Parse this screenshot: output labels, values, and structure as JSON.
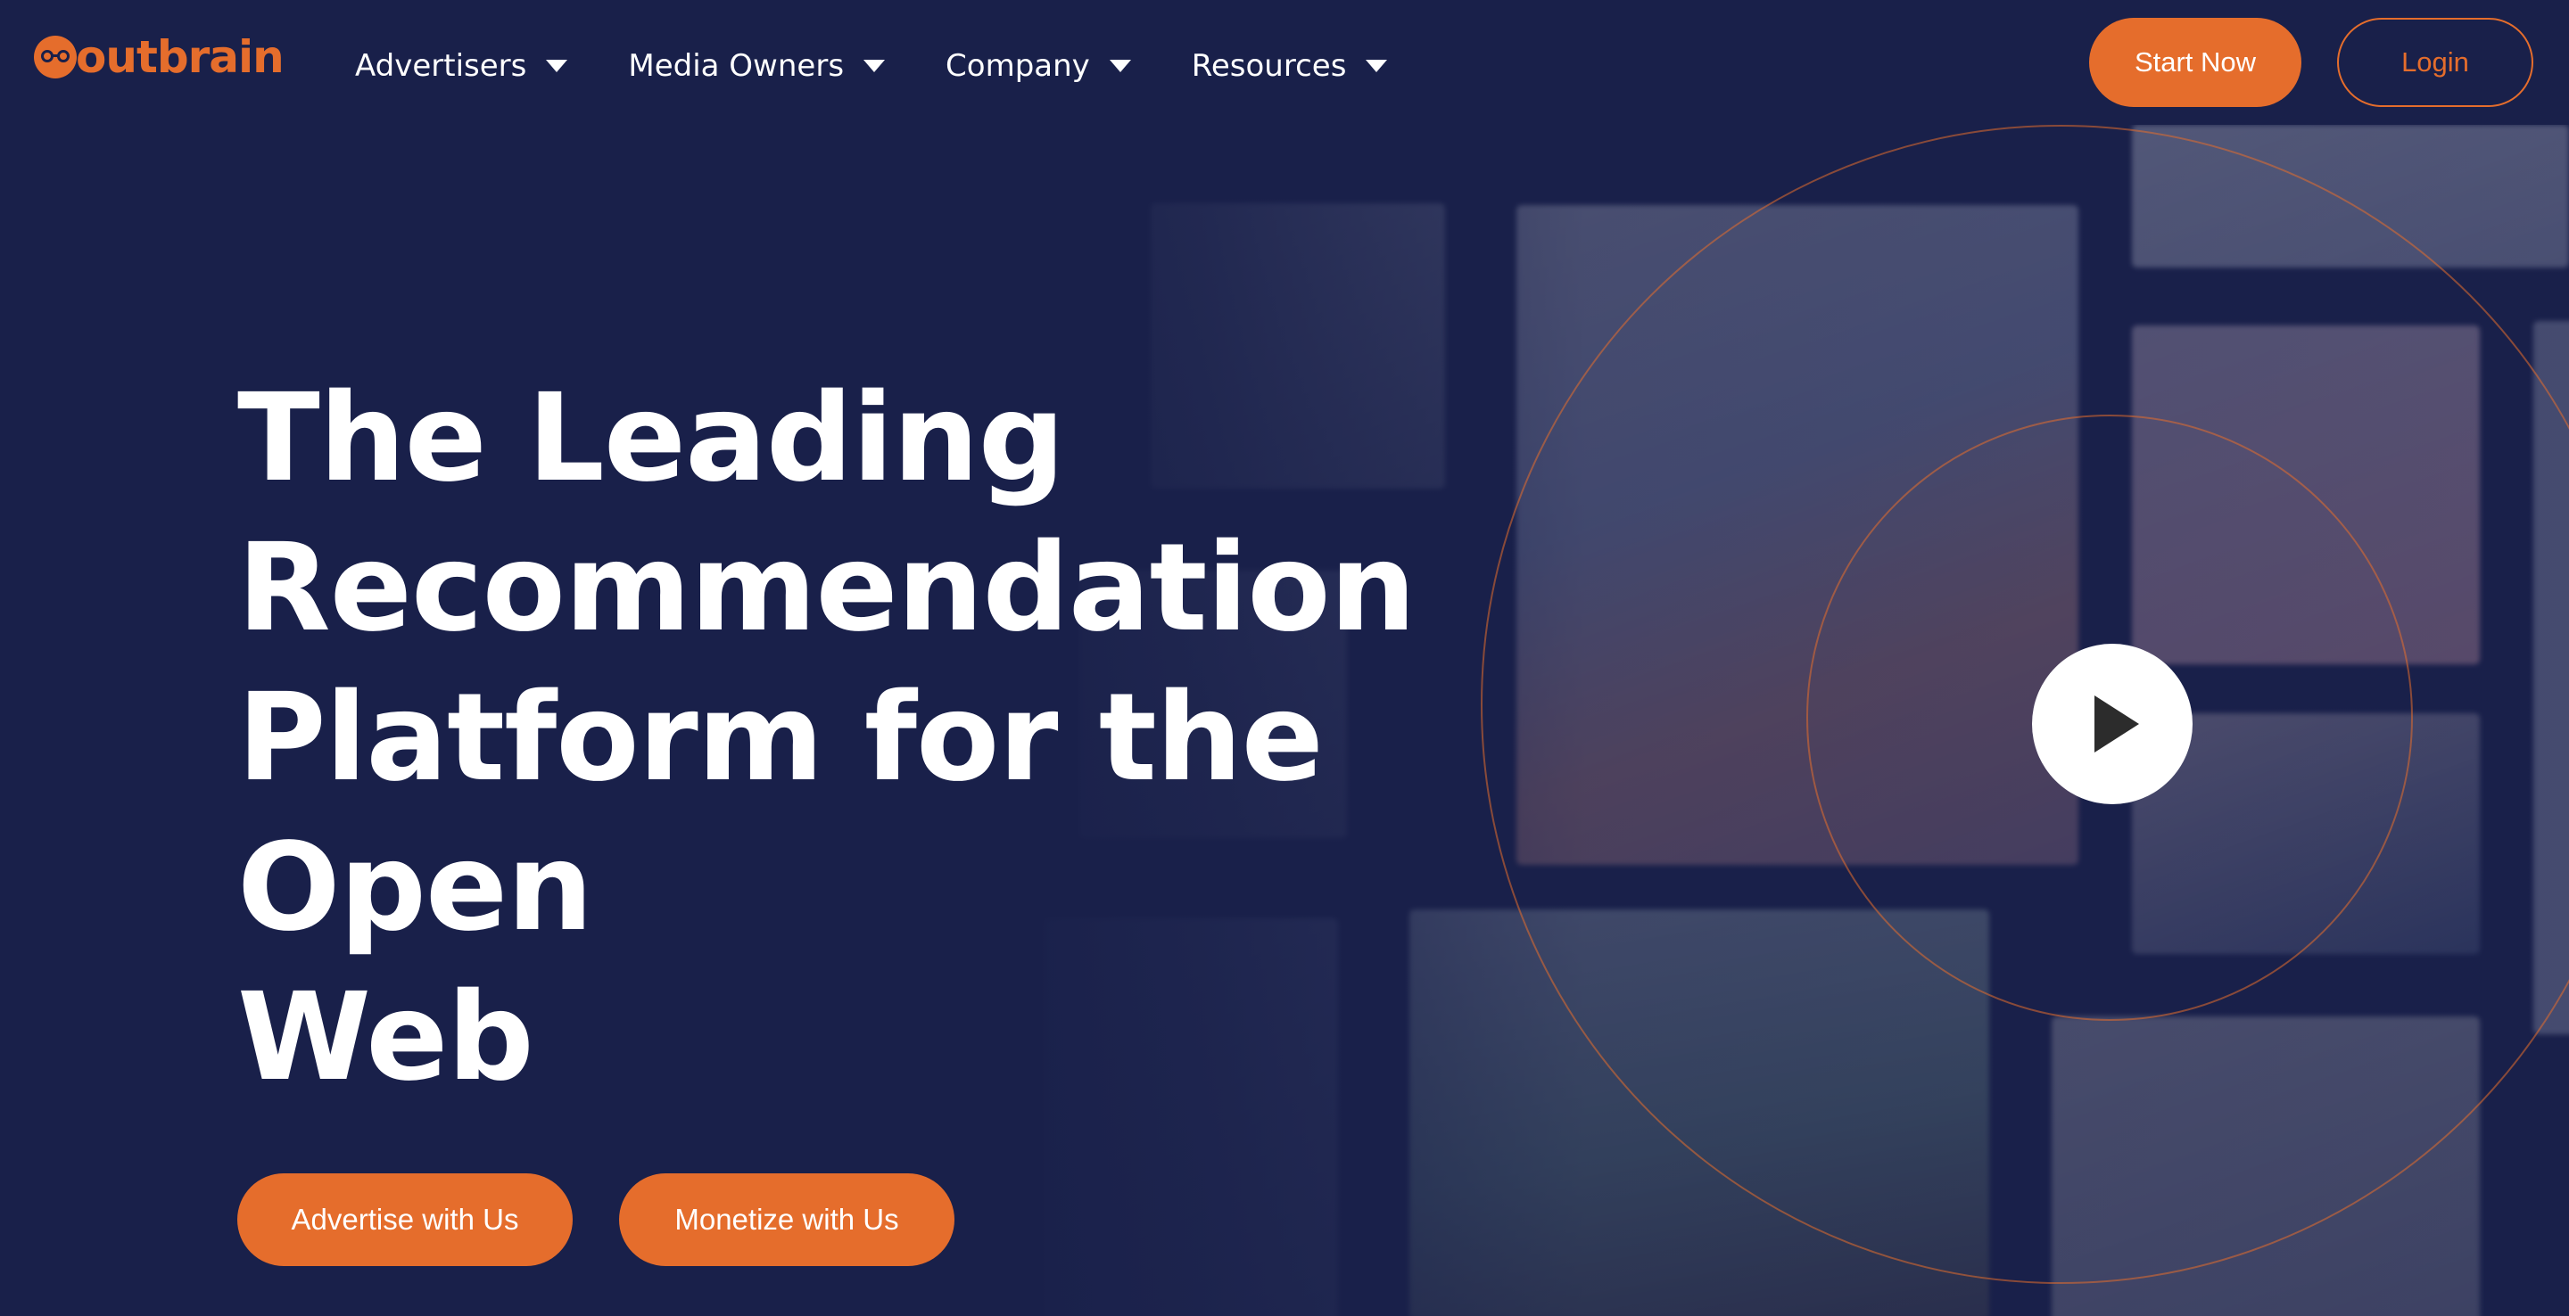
{
  "brand": {
    "name": "outbrain",
    "color": "#e56d2c"
  },
  "nav": {
    "items": [
      {
        "label": "Advertisers"
      },
      {
        "label": "Media Owners"
      },
      {
        "label": "Company"
      },
      {
        "label": "Resources"
      }
    ],
    "start_label": "Start Now",
    "login_label": "Login"
  },
  "hero": {
    "headline_lines": [
      "The Leading",
      "Recommendation",
      "Platform for the Open",
      "Web"
    ],
    "cta_advertise": "Advertise with Us",
    "cta_monetize": "Monetize with Us"
  },
  "colors": {
    "background": "#19204a",
    "accent": "#e56d2c",
    "text": "#ffffff"
  },
  "icons": {
    "menu_caret": "chevron-down-icon",
    "video": "play-icon"
  }
}
